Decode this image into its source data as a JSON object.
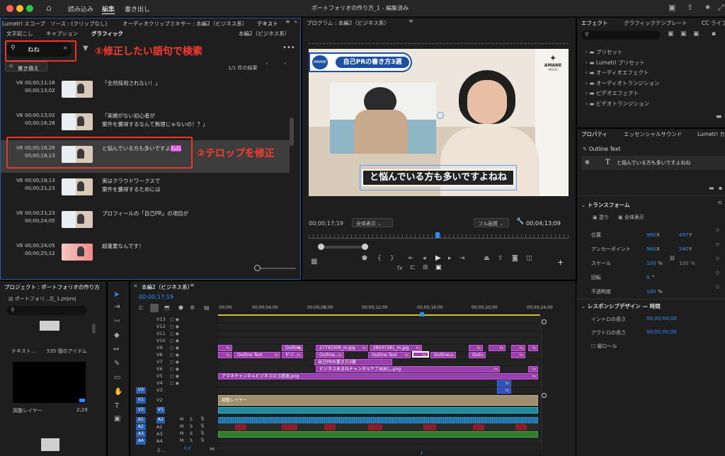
{
  "topbar": {
    "menus": [
      "読み込み",
      "編集",
      "書き出し"
    ],
    "doc_title": "ポートフォリオの作り方_1 - 編集済み"
  },
  "textpanel": {
    "tabs_top": [
      "Lumetri スコープ",
      "ソース : (クリップなし)",
      "オーディオクリップミキサー : 本編2（ビジネス系）",
      "テキスト"
    ],
    "sub_tabs": [
      "文字起こし",
      "キャプション",
      "グラフィック"
    ],
    "sequence_label": "本編2（ビジネス系）",
    "search_value": "ねね",
    "replace_label": "置き換え",
    "result_count": "1/1 件の結果",
    "rows": [
      {
        "track": "V8",
        "in": "00;00;11;16",
        "out": "00;00;13;02",
        "caption": "「全然採用されない！」"
      },
      {
        "track": "V8",
        "in": "00;00;13;02",
        "out": "00;00;16;26",
        "caption": "「実績がない初心者が",
        "caption2": "案件を獲得するなんて無理じゃないの！？」"
      },
      {
        "track": "V8",
        "in": "00;00;16;26",
        "out": "00;00;18;13",
        "caption": "と悩んでいる方も多いですよ",
        "caption_hl": "ねね"
      },
      {
        "track": "V8",
        "in": "00;00;18;13",
        "out": "00;00;21;23",
        "caption": "実はクラウドワークスで",
        "caption2": "案件を獲得するためには"
      },
      {
        "track": "V8",
        "in": "00;00;21;23",
        "out": "00;00;24;05",
        "caption": "プロフィールの「自己PR」の項目が"
      },
      {
        "track": "V8",
        "in": "00;00;24;05",
        "out": "00;00;25;12",
        "caption": "超重要なんです！"
      }
    ]
  },
  "annotations": {
    "step1": "①修正したい語句で検索",
    "step2": "②テロップを修正"
  },
  "program": {
    "title": "プログラム : 本編2（ビジネス系）",
    "video_title_banner": "自己PRの書き方3選",
    "logo_left": "AMANE",
    "logo_right": "AMANE",
    "logo_sub": "MOVIE",
    "subtitle": "と悩んでいる方も多いですよねね",
    "timecode": "00;00;17;19",
    "fit": "全体表示",
    "quality": "フル画質",
    "duration": "00;04;13;09"
  },
  "effects": {
    "tabs": [
      "エフェクト",
      "グラフィックテンプレート",
      "CC ライブ"
    ],
    "items": [
      "プリセット",
      "Lumetri プリセット",
      "オーディオエフェクト",
      "オーディオトランジション",
      "ビデオエフェクト",
      "ビデオトランジション"
    ]
  },
  "props": {
    "tabs": [
      "プロパティ",
      "エッセンシャルサウンド",
      "Lumetri カラ"
    ],
    "layer_type": "Outline Text",
    "text_layer": "と悩んでいる方も多いですよねね",
    "transform": "トランスフォーム",
    "fill": "塗り",
    "show_all": "全体表示",
    "rows": [
      {
        "label": "位置",
        "v1": "960",
        "u1": "X",
        "v2": "497",
        "u2": "Y"
      },
      {
        "label": "アンカーポイント",
        "v1": "960",
        "u1": "X",
        "v2": "540",
        "u2": "Y"
      },
      {
        "label": "スケール",
        "v1": "100",
        "u1": "%",
        "v2": "100",
        "u2": "%"
      },
      {
        "label": "回転",
        "v1": "0",
        "u1": "°"
      },
      {
        "label": "不透明度",
        "v1": "100",
        "u1": "%"
      }
    ],
    "responsive": "レスポンシブデザイン — 時間",
    "intro": "イントロの長さ",
    "intro_v": "00;00;00;00",
    "outro": "アウトロの長さ",
    "outro_v": "00;00;00;00",
    "roll": "縦ロール"
  },
  "project": {
    "title": "プロジェクト : ポートフォリオの作り方",
    "file": "ポートフォリ...方_1.prproj",
    "items": "535 個のアイテム",
    "text_label": "テキスト...",
    "adj_label": "調整レイヤー",
    "adj_dur": "2;29"
  },
  "timeline": {
    "tab": "本編2（ビジネス系）",
    "timecode": "00;00;17;19",
    "ruler": [
      ":00;00",
      "00;00;04;00",
      "00;00;08;00",
      "00;00;12;00",
      "00;00;16;00",
      "00;00;20;00",
      "00;00;24;00"
    ],
    "video_tracks": [
      "V13",
      "V12",
      "V11",
      "V10",
      "V9",
      "V8",
      "V7",
      "V6",
      "V5",
      "V4",
      "V3",
      "V2",
      "V1"
    ],
    "audio_tracks": [
      "A1",
      "A2",
      "A3",
      "A4"
    ],
    "mix_label": "ミ...",
    "mix_value": "0.0",
    "clips_v9": [
      "Outline...",
      "27742309_m.jpg",
      "28207281_m.jpg"
    ],
    "clips_v8": [
      "Outline Text",
      "ビジ...",
      "Outline...",
      "Outline Text",
      "Outline...",
      "Out..."
    ],
    "clip_v7": "自己PRの書き方3選",
    "clip_v6": "ビジネスあまねチャンネルサブ見出し.png",
    "clip_v5": "アマネチャンネルビジネスロゴ透過.png",
    "clip_v2": "調整レイヤー",
    "mute": "M",
    "solo": "S"
  }
}
